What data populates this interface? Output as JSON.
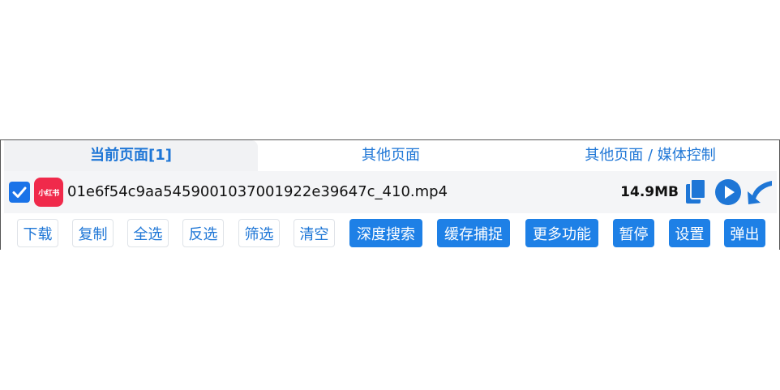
{
  "tabs": [
    {
      "label": "当前页面[1]"
    },
    {
      "label": "其他页面"
    },
    {
      "label": "其他页面 / 媒体控制"
    }
  ],
  "media_item": {
    "checked": true,
    "site_badge": "小红书",
    "filename": "01e6f54c9aa5459001037001922e39647c_410.mp4",
    "size": "14.9MB"
  },
  "toolbar": {
    "download": "下载",
    "copy": "复制",
    "select_all": "全选",
    "invert": "反选",
    "filter": "筛选",
    "clear": "清空",
    "deep_search": "深度搜索",
    "cache_capture": "缓存捕捉",
    "more": "更多功能",
    "pause": "暂停",
    "settings": "设置",
    "popup": "弹出"
  },
  "colors": {
    "accent": "#1e76d6",
    "button_fill": "#1e80e6",
    "badge": "#f02a4b"
  }
}
